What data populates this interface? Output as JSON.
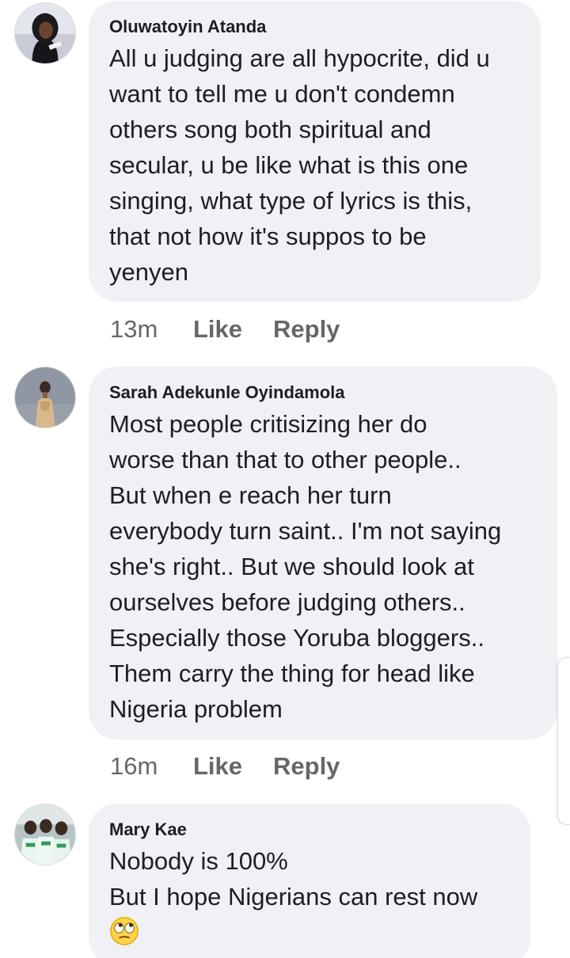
{
  "comments": [
    {
      "author": "Oluwatoyin Atanda",
      "text": "All u judging are all hypocrite, did u\nwant to tell me u don't condemn\nothers song both spiritual and\nsecular, u be like what is this one\nsinging, what type of lyrics is this,\nthat not how it's suppos to be\nyenyen",
      "time": "13m",
      "like_label": "Like",
      "reply_label": "Reply"
    },
    {
      "author": "Sarah Adekunle Oyindamola",
      "text": "Most people critisizing her do\nworse than that to other people..\nBut when e reach her turn\neverybody turn saint.. I'm not saying\nshe's right.. But we should look at\nourselves before judging others..\nEspecially those Yoruba bloggers..\nThem carry the thing for head like\nNigeria problem",
      "time": "16m",
      "like_label": "Like",
      "reply_label": "Reply"
    },
    {
      "author": "Mary Kae",
      "text": "Nobody is 100%\nBut I hope Nigerians can rest now",
      "emoji": "face-with-rolling-eyes-emoji"
    }
  ],
  "colors": {
    "bubble_bg": "#eff1f4",
    "text": "#1c1e21",
    "meta": "#65676b"
  }
}
